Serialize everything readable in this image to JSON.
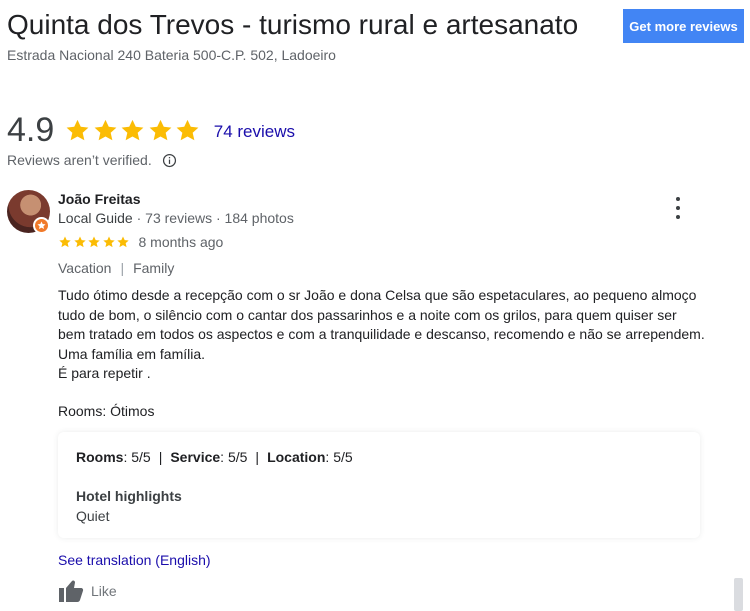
{
  "place": {
    "title": "Quinta dos Trevos - turismo rural e artesanato",
    "address": "Estrada Nacional 240 Bateria 500-C.P. 502, Ladoeiro"
  },
  "cta": {
    "label": "Get more reviews"
  },
  "summary": {
    "rating": "4.9",
    "star_count": 5,
    "reviews_link": "74 reviews",
    "verification_note": "Reviews aren’t verified.",
    "star_color": "#fbbc04"
  },
  "review": {
    "author": "João Freitas",
    "author_badge": "Local Guide",
    "author_reviews": "73 reviews",
    "author_photos": "184 photos",
    "meta_separator": "·",
    "stars": 5,
    "date": "8 months ago",
    "tags": [
      "Vacation",
      "Family"
    ],
    "tag_separator": "|",
    "text_lines": [
      "Tudo ótimo desde a recepção com o sr João e dona Celsa que são espetaculares, ao pequeno almoço",
      "tudo de bom, o silêncio com o cantar dos passarinhos e a noite com os grilos, para quem quiser ser",
      "bem tratado em todos os aspectos e com a tranquilidade e descanso, recomendo e não se arrependem.",
      "Uma família em família.",
      "É para repetir ."
    ],
    "rooms_note": "Rooms: Ótimos",
    "scores": [
      {
        "label": "Rooms",
        "value": "5/5"
      },
      {
        "label": "Service",
        "value": "5/5"
      },
      {
        "label": "Location",
        "value": "5/5"
      }
    ],
    "score_separator": "|",
    "highlights_title": "Hotel highlights",
    "highlights_value": "Quiet",
    "translate_link": "See translation (English)",
    "like_label": "Like"
  },
  "colors": {
    "link": "#1a0dab",
    "button_blue": "#4285f4",
    "guide_badge": "#f17a2a"
  },
  "icons": {
    "star": "star-icon",
    "info": "info-icon",
    "more": "more-vert-icon",
    "like": "thumb-up-icon",
    "guide": "local-guide-badge-icon"
  }
}
